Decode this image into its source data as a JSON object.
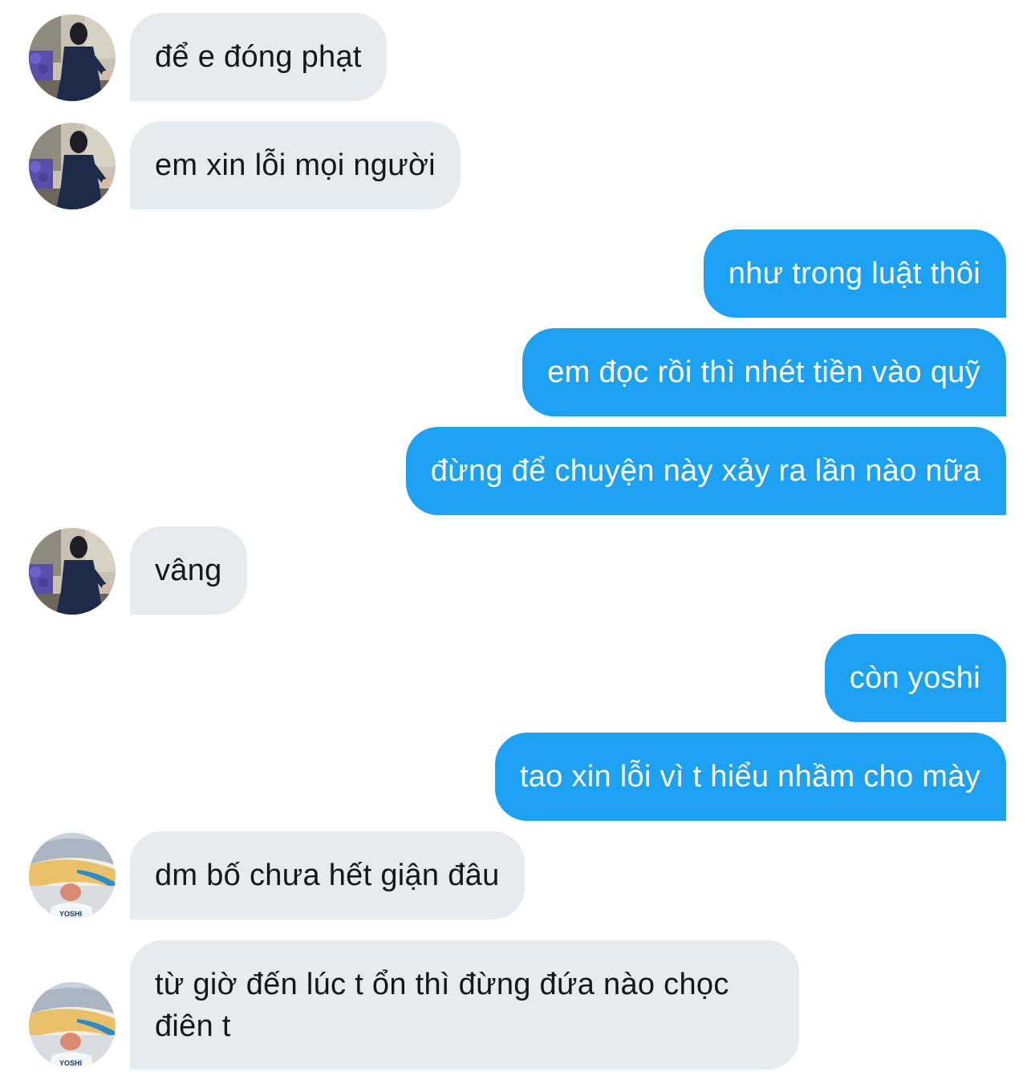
{
  "conversation": {
    "messages": [
      {
        "direction": "incoming",
        "sender_avatar": "user-a-avatar",
        "text": "để e đóng phạt"
      },
      {
        "direction": "incoming",
        "sender_avatar": "user-a-avatar",
        "text": "em xin lỗi mọi người"
      },
      {
        "direction": "outgoing",
        "text": "như trong luật thôi"
      },
      {
        "direction": "outgoing",
        "text": "em đọc rồi thì nhét tiền vào quỹ"
      },
      {
        "direction": "outgoing",
        "text": "đừng để chuyện này xảy ra lần nào nữa"
      },
      {
        "direction": "incoming",
        "sender_avatar": "user-a-avatar",
        "text": "vâng"
      },
      {
        "direction": "outgoing",
        "text": "còn yoshi"
      },
      {
        "direction": "outgoing",
        "text": "tao xin lỗi vì t hiểu nhầm cho mày"
      },
      {
        "direction": "incoming",
        "sender_avatar": "user-b-avatar",
        "text": "dm bố chưa hết giận đâu"
      },
      {
        "direction": "incoming",
        "sender_avatar": "user-b-avatar",
        "text": "từ giờ đến lúc t ổn thì đừng đứa nào chọc điên t"
      }
    ],
    "avatar_b_shirt_text": "YOSHI"
  },
  "colors": {
    "background": "#ffffff",
    "incoming_bubble": "#e7ebee",
    "incoming_text": "#14171a",
    "outgoing_bubble": "#1da1f2",
    "outgoing_text": "#ffffff"
  }
}
